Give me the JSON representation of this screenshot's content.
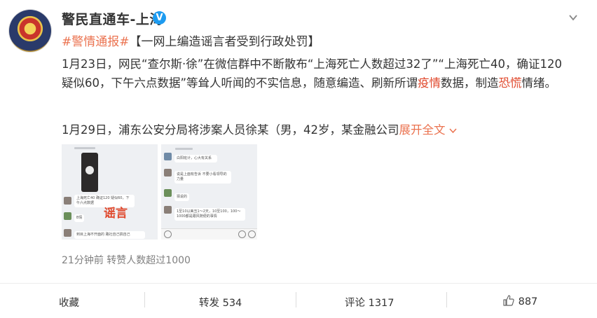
{
  "header": {
    "username": "警民直通车-上海",
    "verified_mark": "V"
  },
  "post": {
    "hashtag": "#警情通报#",
    "title": "【一网上编造谣言者受到行政处罚】",
    "p1": {
      "line1": "1月23日，网民“查尔斯·徐”在微信群中不断散布“上海死亡人数超过32了”“上海死亡40，确证120",
      "line2_a": "疑似60，下午六点数据”等耸人听闻的不实信息，随意编造、刷新所谓",
      "kw1": "疫情",
      "line2_b": "数据，制造",
      "kw2": "恐慌",
      "line2_c": "情绪。"
    },
    "p2": "1月29日，浦东公安分局将涉案人员徐某（男，42岁，某金融公司",
    "expand_label": "展开全文",
    "rumor_stamp": "谣言",
    "chat1": {
      "msg_a": "上海死亡40 确证120 疑似60，下午六点数据",
      "msg_b": "B情",
      "msg_c": "到目上海不开面的 路社自己搞自己"
    },
    "chat2": {
      "msg_a": "白阳班计，心大有关系",
      "msg_b": "说是上面有告诉 不要小看领导的力量",
      "msg_c": "猜说的",
      "msg_d": "1至10以美丑1～2天，10至100，100～1000都是跟风随便的事情"
    }
  },
  "meta": {
    "time": "21分钟前",
    "likes_note": "转赞人数超过1000"
  },
  "footer": {
    "favorite": "收藏",
    "repost": "转发 534",
    "comment": "评论 1317",
    "like_count": "887"
  }
}
